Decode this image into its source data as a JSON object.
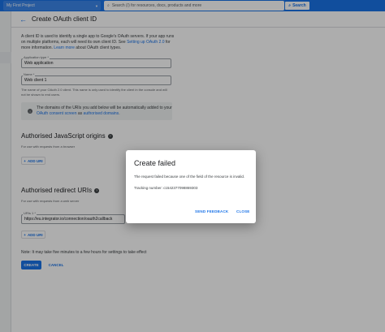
{
  "topbar": {
    "project_name": "My First Project",
    "project_icon": "dropdown-triangle",
    "search_placeholder": "Search (/) for resources, docs, products and more",
    "search_button": "Search",
    "brand_color": "#1a73e8"
  },
  "page": {
    "back_icon": "arrow-left-icon",
    "title": "Create OAuth client ID"
  },
  "intro": {
    "text1": "A client ID is used to identify a single app to Google's OAuth servers. If your app runs on multiple platforms, each will need its own client ID. See ",
    "link1": "Setting up OAuth 2.0",
    "text2": " for more information. ",
    "link2": "Learn more",
    "text3": " about OAuth client types."
  },
  "form": {
    "app_type_label": "Application type *",
    "app_type_value": "Web application",
    "name_label": "Name *",
    "name_value": "Web client 1",
    "name_helper": "The name of your OAuth 2.0 client. This name is only used to identify the client in the console and will not be shown to end users."
  },
  "notice": {
    "text1": "The domains of the URIs you add below will be automatically added to your ",
    "link1": "OAuth consent screen",
    "text2": " as ",
    "link2": "authorised domains",
    "text3": "."
  },
  "js_origins": {
    "heading": "Authorised JavaScript origins",
    "sub": "For use with requests from a browser",
    "add_label": "ADD URI"
  },
  "redirect_uris": {
    "heading": "Authorised redirect URIs",
    "sub": "For use with requests from a web server",
    "uri_label": "URIs 1 *",
    "uri_value": "https://eu.integrator.io/connection/oauth2callback",
    "add_label": "ADD URI"
  },
  "footer": {
    "note": "Note: It may take five minutes to a few hours for settings to take effect",
    "create_label": "CREATE",
    "cancel_label": "CANCEL"
  },
  "dialog": {
    "title": "Create failed",
    "message": "The request failed because one of the field of the resource is invalid.",
    "tracking": "Tracking number: c1542377098869303",
    "send_feedback": "SEND FEEDBACK",
    "close": "CLOSE"
  }
}
